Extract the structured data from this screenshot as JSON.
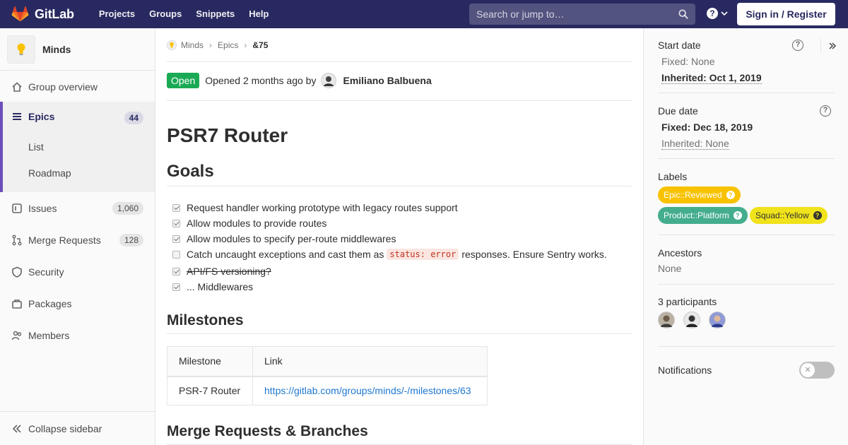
{
  "navbar": {
    "brand": "GitLab",
    "links": [
      "Projects",
      "Groups",
      "Snippets",
      "Help"
    ],
    "search_placeholder": "Search or jump to…",
    "signin_label": "Sign in / Register",
    "help_symbol": "?"
  },
  "sidebar": {
    "group_name": "Minds",
    "items": {
      "overview": "Group overview",
      "epics": "Epics",
      "epics_count": "44",
      "list": "List",
      "roadmap": "Roadmap",
      "issues": "Issues",
      "issues_count": "1,060",
      "merge_requests": "Merge Requests",
      "merge_requests_count": "128",
      "security": "Security",
      "packages": "Packages",
      "members": "Members"
    },
    "collapse_label": "Collapse sidebar"
  },
  "breadcrumb": {
    "group": "Minds",
    "section": "Epics",
    "current": "&75"
  },
  "epic": {
    "status": "Open",
    "opened_text": "Opened 2 months ago by",
    "author": "Emiliano Balbuena",
    "title": "PSR7 Router"
  },
  "goals": {
    "heading": "Goals",
    "tasks": [
      {
        "text": "Request handler working prototype with legacy routes support",
        "checked": true,
        "strike": false
      },
      {
        "text": "Allow modules to provide routes",
        "checked": true,
        "strike": false
      },
      {
        "text": "Allow modules to specify per-route middlewares",
        "checked": true,
        "strike": false
      },
      {
        "text_before": "Catch uncaught exceptions and cast them as",
        "code": "status: error",
        "text_after": "responses. Ensure Sentry works.",
        "checked": false,
        "strike": false
      },
      {
        "text": "API/FS versioning?",
        "checked": true,
        "strike": true
      },
      {
        "text": "... Middlewares",
        "checked": true,
        "strike": false
      }
    ]
  },
  "milestones": {
    "heading": "Milestones",
    "columns": [
      "Milestone",
      "Link"
    ],
    "rows": [
      [
        "PSR-7 Router",
        "https://gitlab.com/groups/minds/-/milestones/63"
      ]
    ]
  },
  "merge_heading": "Merge Requests & Branches",
  "right": {
    "start_date": {
      "title": "Start date",
      "fixed_label": "Fixed:",
      "fixed_value": "None",
      "inherited_label": "Inherited:",
      "inherited_value": "Oct 1, 2019"
    },
    "due_date": {
      "title": "Due date",
      "fixed_label": "Fixed:",
      "fixed_value": "Dec 18, 2019",
      "inherited_label": "Inherited:",
      "inherited_value": "None"
    },
    "labels_title": "Labels",
    "labels": [
      {
        "text": "Epic::Reviewed",
        "bg": "#f8c200",
        "fg": "#ffffff"
      },
      {
        "text": "Product::Platform",
        "bg": "#44ad8e",
        "fg": "#ffffff"
      },
      {
        "text": "Squad::Yellow",
        "bg": "#f0e21b",
        "fg": "#333333"
      }
    ],
    "ancestors_title": "Ancestors",
    "ancestors_value": "None",
    "participants_title": "3 participants",
    "notifications_title": "Notifications"
  },
  "colors": {
    "navbar_bg": "#292961",
    "open_badge": "#1aaa55",
    "link": "#1f78d1",
    "active_border": "#6b4fbb"
  }
}
